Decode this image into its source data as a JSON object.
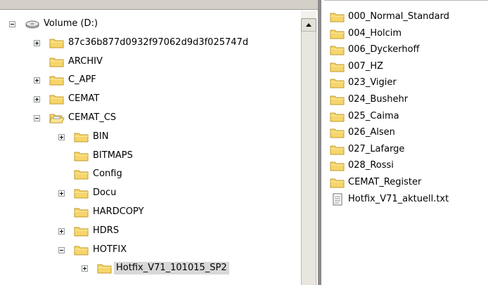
{
  "tree": {
    "items": [
      {
        "label": "Volume (D:)",
        "depth": 0,
        "icon": "drive-icon",
        "expander": "minus"
      },
      {
        "label": "87c36b877d0932f97062d9d3f025747d",
        "depth": 1,
        "icon": "folder-icon",
        "expander": "plus"
      },
      {
        "label": "ARCHIV",
        "depth": 1,
        "icon": "folder-icon",
        "expander": "none"
      },
      {
        "label": "C_APF",
        "depth": 1,
        "icon": "folder-icon",
        "expander": "plus"
      },
      {
        "label": "CEMAT",
        "depth": 1,
        "icon": "folder-icon",
        "expander": "plus"
      },
      {
        "label": "CEMAT_CS",
        "depth": 1,
        "icon": "folder-open-icon",
        "expander": "minus"
      },
      {
        "label": "BIN",
        "depth": 2,
        "icon": "folder-icon",
        "expander": "plus"
      },
      {
        "label": "BITMAPS",
        "depth": 2,
        "icon": "folder-icon",
        "expander": "none"
      },
      {
        "label": "Config",
        "depth": 2,
        "icon": "folder-icon",
        "expander": "none"
      },
      {
        "label": "Docu",
        "depth": 2,
        "icon": "folder-icon",
        "expander": "plus"
      },
      {
        "label": "HARDCOPY",
        "depth": 2,
        "icon": "folder-icon",
        "expander": "none"
      },
      {
        "label": "HDRS",
        "depth": 2,
        "icon": "folder-icon",
        "expander": "plus"
      },
      {
        "label": "HOTFIX",
        "depth": 2,
        "icon": "folder-icon",
        "expander": "minus"
      },
      {
        "label": "Hotfix_V71_101015_SP2",
        "depth": 3,
        "icon": "folder-icon",
        "expander": "plus",
        "selected": true
      }
    ]
  },
  "list": {
    "items": [
      {
        "label": "000_Normal_Standard",
        "icon": "folder-icon"
      },
      {
        "label": "004_Holcim",
        "icon": "folder-icon"
      },
      {
        "label": "006_Dyckerhoff",
        "icon": "folder-icon"
      },
      {
        "label": "007_HZ",
        "icon": "folder-icon"
      },
      {
        "label": "023_Vigier",
        "icon": "folder-icon"
      },
      {
        "label": "024_Bushehr",
        "icon": "folder-icon"
      },
      {
        "label": "025_Caima",
        "icon": "folder-icon"
      },
      {
        "label": "026_Alsen",
        "icon": "folder-icon"
      },
      {
        "label": "027_Lafarge",
        "icon": "folder-icon"
      },
      {
        "label": "028_Rossi",
        "icon": "folder-icon"
      },
      {
        "label": "CEMAT_Register",
        "icon": "folder-icon"
      },
      {
        "label": "Hotfix_V71_aktuell.txt",
        "icon": "text-file-icon"
      }
    ]
  },
  "colors": {
    "folder_fill": "#f6d66b",
    "folder_stroke": "#c29a2b",
    "selection": "#d8d8d8"
  }
}
